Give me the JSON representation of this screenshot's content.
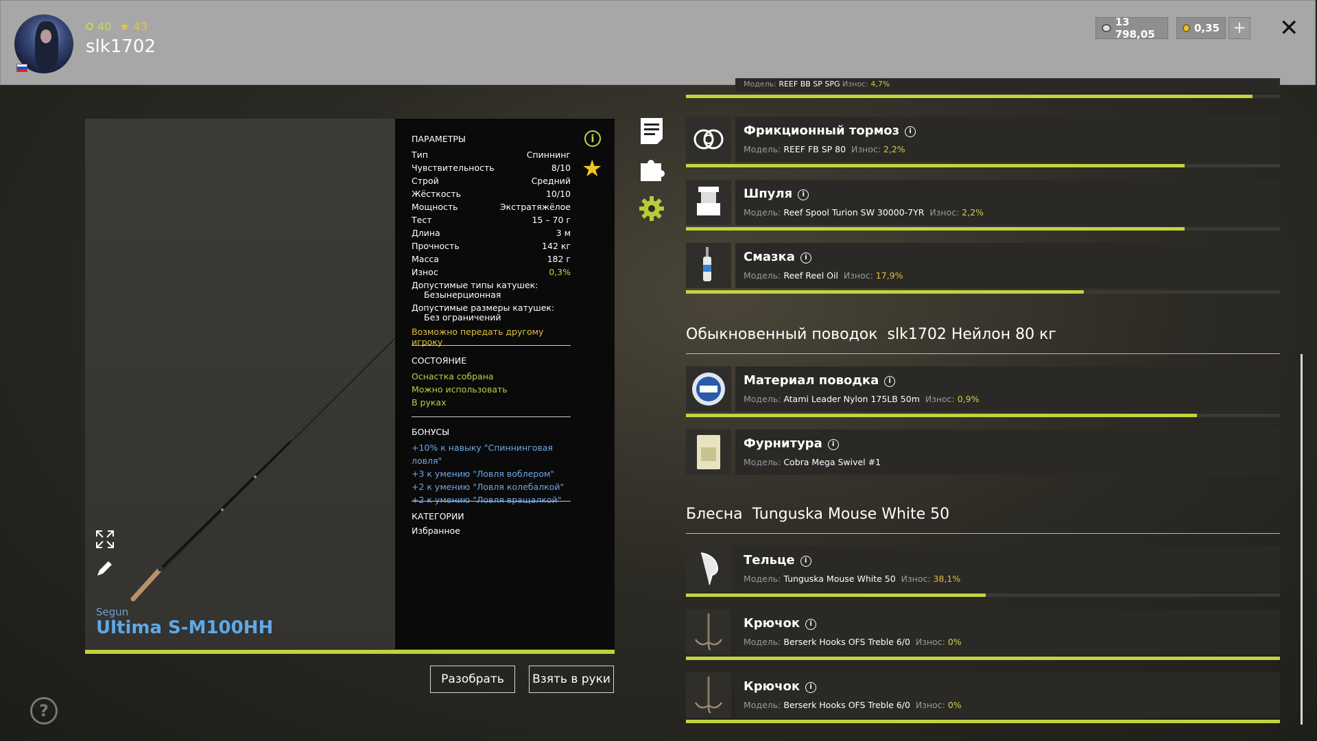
{
  "header": {
    "level": "40",
    "rank": "43",
    "username": "slk1702",
    "currency_silver": "13 798,05",
    "currency_gold": "0,35",
    "plus_label": "+",
    "close_label": "✕"
  },
  "rod": {
    "brand": "Segun",
    "model": "Ultima S-M100HH"
  },
  "params": {
    "title": "ПАРАМЕТРЫ",
    "rows": [
      {
        "k": "Тип",
        "v": "Спиннинг"
      },
      {
        "k": "Чувствительность",
        "v": "8/10"
      },
      {
        "k": "Строй",
        "v": "Средний"
      },
      {
        "k": "Жёсткость",
        "v": "10/10"
      },
      {
        "k": "Мощность",
        "v": "Экстратяжёлое"
      },
      {
        "k": "Тест",
        "v": "15 – 70 г"
      },
      {
        "k": "Длина",
        "v": "3 м"
      },
      {
        "k": "Прочность",
        "v": "142 кг"
      },
      {
        "k": "Масса",
        "v": "182 г"
      },
      {
        "k": "Износ",
        "v": "0,3%"
      }
    ],
    "reel_types_label": "Допустимые типы катушек:",
    "reel_types_value": "Безынерционная",
    "reel_sizes_label": "Допустимые размеры катушек:",
    "reel_sizes_value": "Без ограничений",
    "transfer": "Возможно передать другому игроку"
  },
  "state": {
    "title": "СОСТОЯНИЕ",
    "lines": [
      "Оснастка собрана",
      "Можно использовать",
      "В руках"
    ]
  },
  "bonuses": {
    "title": "БОНУСЫ",
    "lines": [
      "+10% к навыку \"Спиннинговая ловля\"",
      "+3 к умению \"Ловля воблером\"",
      "+2 к умению \"Ловля колебалкой\"",
      "+2 к умению \"Ловля вращалкой\""
    ]
  },
  "categories": {
    "title": "КАТЕГОРИИ",
    "value": "Избранное"
  },
  "buttons": {
    "disassemble": "Разобрать",
    "take": "Взять в руки",
    "help": "?"
  },
  "labels": {
    "model": "Модель:",
    "wear": "Износ:"
  },
  "partial_item": {
    "model": "REEF BB SP SPG",
    "wear": "4,7%",
    "bar_fill": 0.82
  },
  "items": [
    {
      "name": "Фрикционный тормоз",
      "model": "REEF FB SP 80",
      "wear": "2,2%",
      "bar_fill": 0.84,
      "icon": "friction-brake-icon"
    },
    {
      "name": "Шпуля",
      "model": "Reef Spool Turion SW 30000-7YR",
      "wear": "2,2%",
      "bar_fill": 0.84,
      "icon": "spool-icon"
    },
    {
      "name": "Смазка",
      "model": "Reef Reel Oil",
      "wear": "17,9%",
      "bar_fill": 0.67,
      "icon": "reel-oil-icon"
    }
  ],
  "group_leader": {
    "label": "Обыкновенный поводок",
    "value": "slk1702 Нейлон 80 кг"
  },
  "leader_items": [
    {
      "name": "Материал поводка",
      "model": "Atami Leader Nylon 175LB 50m",
      "wear": "0,9%",
      "bar_fill": 0.86,
      "icon": "leader-material-icon"
    },
    {
      "name": "Фурнитура",
      "model": "Cobra Mega Swivel #1",
      "wear": "",
      "bar_fill": 0,
      "icon": "swivel-icon"
    }
  ],
  "group_lure": {
    "label": "Блесна",
    "value": "Tunguska Mouse White 50"
  },
  "lure_items": [
    {
      "name": "Тельце",
      "model": "Tunguska Mouse White 50",
      "wear": "38,1%",
      "bar_fill": 0.505,
      "icon": "lure-body-icon"
    },
    {
      "name": "Крючок",
      "model": "Berserk Hooks OFS Treble 6/0",
      "wear": "0%",
      "bar_fill": 1.0,
      "icon": "treble-hook-icon"
    },
    {
      "name": "Крючок",
      "model": "Berserk Hooks OFS Treble 6/0",
      "wear": "0%",
      "bar_fill": 1.0,
      "icon": "treble-hook-icon"
    }
  ],
  "colors": {
    "accent_green": "#c2d43f",
    "wear_yellow": "#e0c040",
    "link_blue": "#6ea8e0"
  }
}
